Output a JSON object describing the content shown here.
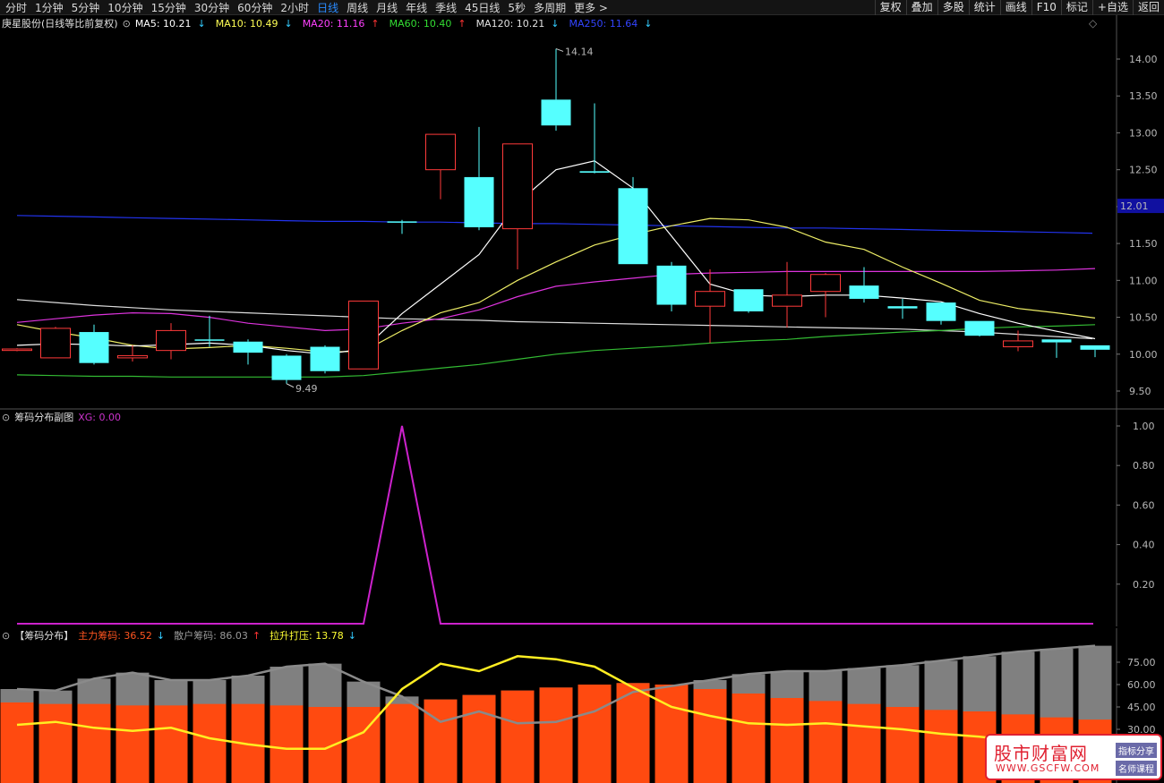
{
  "toolbar": {
    "periods": [
      "分时",
      "1分钟",
      "5分钟",
      "10分钟",
      "15分钟",
      "30分钟",
      "60分钟",
      "2小时",
      "日线",
      "周线",
      "月线",
      "年线",
      "季线",
      "45日线",
      "5秒",
      "多周期",
      "更多 >"
    ],
    "active_period": "日线",
    "tools": [
      "复权",
      "叠加",
      "多股",
      "统计",
      "画线",
      "F10",
      "标记",
      "+自选",
      "返回"
    ]
  },
  "main_panel": {
    "title": "庚星股份(日线等比前复权)",
    "ma": [
      {
        "label": "MA5: 10.21",
        "arrow": "↓",
        "color": "#ffffff"
      },
      {
        "label": "MA10: 10.49",
        "arrow": "↓",
        "color": "#ffff55"
      },
      {
        "label": "MA20: 11.16",
        "arrow": "↑",
        "color": "#ff40ff"
      },
      {
        "label": "MA60: 10.40",
        "arrow": "↑",
        "color": "#33dd33"
      },
      {
        "label": "MA120: 10.21",
        "arrow": "↓",
        "color": "#e0e0e0"
      },
      {
        "label": "MA250: 11.64",
        "arrow": "↓",
        "color": "#3344ff"
      }
    ],
    "price_ticks": [
      "14.00",
      "13.50",
      "13.00",
      "12.50",
      "12.00",
      "11.50",
      "11.00",
      "10.50",
      "10.00",
      "9.50"
    ],
    "current_price_tag": "12.01",
    "high_label": "14.14",
    "low_label": "9.49",
    "candles": [
      {
        "o": 10.05,
        "c": 10.07,
        "h": 10.08,
        "l": 10.04
      },
      {
        "o": 9.95,
        "c": 10.35,
        "h": 10.37,
        "l": 9.95
      },
      {
        "o": 10.3,
        "c": 9.88,
        "h": 10.4,
        "l": 9.86
      },
      {
        "o": 9.95,
        "c": 9.98,
        "h": 10.12,
        "l": 9.9
      },
      {
        "o": 10.05,
        "c": 10.32,
        "h": 10.42,
        "l": 9.93
      },
      {
        "o": 10.2,
        "c": 10.2,
        "h": 10.52,
        "l": 10.1
      },
      {
        "o": 10.17,
        "c": 10.02,
        "h": 10.2,
        "l": 9.86
      },
      {
        "o": 9.98,
        "c": 9.65,
        "h": 10.0,
        "l": 9.6
      },
      {
        "o": 10.1,
        "c": 9.77,
        "h": 10.12,
        "l": 9.74
      },
      {
        "o": 9.8,
        "c": 10.72,
        "h": 10.72,
        "l": 9.8
      },
      {
        "o": 11.8,
        "c": 11.8,
        "h": 11.82,
        "l": 11.63
      },
      {
        "o": 12.5,
        "c": 12.98,
        "h": 12.98,
        "l": 12.1
      },
      {
        "o": 12.4,
        "c": 11.72,
        "h": 13.08,
        "l": 11.68
      },
      {
        "o": 11.7,
        "c": 12.85,
        "h": 12.85,
        "l": 11.15
      },
      {
        "o": 13.45,
        "c": 13.1,
        "h": 14.14,
        "l": 13.03
      },
      {
        "o": 12.48,
        "c": 12.46,
        "h": 13.4,
        "l": 12.45
      },
      {
        "o": 12.25,
        "c": 11.22,
        "h": 12.4,
        "l": 11.22
      },
      {
        "o": 11.2,
        "c": 10.67,
        "h": 11.25,
        "l": 10.58
      },
      {
        "o": 10.65,
        "c": 10.85,
        "h": 11.15,
        "l": 10.15
      },
      {
        "o": 10.88,
        "c": 10.58,
        "h": 10.88,
        "l": 10.56
      },
      {
        "o": 10.65,
        "c": 10.8,
        "h": 11.25,
        "l": 10.36
      },
      {
        "o": 10.85,
        "c": 11.08,
        "h": 11.1,
        "l": 10.5
      },
      {
        "o": 10.93,
        "c": 10.75,
        "h": 11.18,
        "l": 10.7
      },
      {
        "o": 10.65,
        "c": 10.62,
        "h": 10.75,
        "l": 10.48
      },
      {
        "o": 10.7,
        "c": 10.45,
        "h": 10.7,
        "l": 10.4
      },
      {
        "o": 10.45,
        "c": 10.25,
        "h": 10.45,
        "l": 10.24
      },
      {
        "o": 10.1,
        "c": 10.18,
        "h": 10.32,
        "l": 10.04
      },
      {
        "o": 10.2,
        "c": 10.16,
        "h": 10.2,
        "l": 9.95
      },
      {
        "o": 10.12,
        "c": 10.06,
        "h": 10.12,
        "l": 9.96
      }
    ],
    "ma_lines": {
      "ma5": [
        10.12,
        10.14,
        10.13,
        10.11,
        10.13,
        10.15,
        10.12,
        10.05,
        10.0,
        10.07,
        10.55,
        10.95,
        11.35,
        12.05,
        12.5,
        12.62,
        12.25,
        11.6,
        10.95,
        10.8,
        10.78,
        10.8,
        10.8,
        10.76,
        10.71,
        10.55,
        10.42,
        10.31,
        10.21
      ],
      "ma10": [
        10.4,
        10.3,
        10.22,
        10.12,
        10.07,
        10.09,
        10.12,
        10.08,
        10.03,
        10.04,
        10.32,
        10.56,
        10.7,
        11.0,
        11.25,
        11.48,
        11.62,
        11.74,
        11.84,
        11.82,
        11.72,
        11.52,
        11.42,
        11.18,
        10.96,
        10.73,
        10.62,
        10.56,
        10.49
      ],
      "ma20": [
        10.43,
        10.48,
        10.53,
        10.56,
        10.55,
        10.5,
        10.42,
        10.37,
        10.32,
        10.34,
        10.42,
        10.48,
        10.6,
        10.78,
        10.92,
        10.98,
        11.03,
        11.08,
        11.1,
        11.11,
        11.12,
        11.12,
        11.12,
        11.12,
        11.12,
        11.12,
        11.13,
        11.14,
        11.16
      ],
      "ma60": [
        9.72,
        9.71,
        9.7,
        9.7,
        9.69,
        9.69,
        9.69,
        9.69,
        9.69,
        9.71,
        9.76,
        9.81,
        9.86,
        9.93,
        10.0,
        10.05,
        10.08,
        10.11,
        10.15,
        10.18,
        10.2,
        10.24,
        10.27,
        10.3,
        10.32,
        10.35,
        10.37,
        10.38,
        10.4
      ],
      "ma120": [
        10.74,
        10.7,
        10.66,
        10.63,
        10.6,
        10.58,
        10.56,
        10.54,
        10.52,
        10.5,
        10.48,
        10.47,
        10.46,
        10.44,
        10.43,
        10.42,
        10.41,
        10.4,
        10.39,
        10.38,
        10.37,
        10.36,
        10.35,
        10.34,
        10.32,
        10.3,
        10.27,
        10.24,
        10.21
      ],
      "ma250": [
        11.88,
        11.87,
        11.86,
        11.85,
        11.84,
        11.83,
        11.82,
        11.81,
        11.8,
        11.8,
        11.79,
        11.79,
        11.78,
        11.77,
        11.77,
        11.76,
        11.75,
        11.74,
        11.73,
        11.72,
        11.71,
        11.71,
        11.7,
        11.69,
        11.68,
        11.67,
        11.66,
        11.65,
        11.64
      ]
    }
  },
  "sub_panel1": {
    "title": "筹码分布副图",
    "xg_label": "XG: 0.00",
    "ticks": [
      "1.00",
      "0.80",
      "0.60",
      "0.40",
      "0.20"
    ],
    "xg_values": [
      0,
      0,
      0,
      0,
      0,
      0,
      0,
      0,
      0,
      0,
      1,
      0,
      0,
      0,
      0,
      0,
      0,
      0,
      0,
      0,
      0,
      0,
      0,
      0,
      0,
      0,
      0,
      0,
      0
    ]
  },
  "sub_panel2": {
    "title": "【筹码分布】",
    "main_label": "主力筹码: 36.52",
    "main_arrow": "↓",
    "retail_label": "散户筹码: 86.03",
    "retail_arrow": "↑",
    "pressure_label": "拉升打压: 13.78",
    "pressure_arrow": "↓",
    "ticks": [
      "75.00",
      "60.00",
      "45.00",
      "30.00"
    ],
    "main_values": [
      48,
      47,
      47,
      46,
      46,
      47,
      47,
      46,
      45,
      45,
      47,
      50,
      53,
      56,
      58,
      60,
      61,
      60,
      57,
      54,
      51,
      49,
      47,
      45,
      43,
      42,
      40,
      38,
      36.52
    ],
    "retail_values": [
      57,
      56,
      64,
      68,
      63,
      63,
      66,
      72,
      74,
      62,
      52,
      35,
      42,
      34,
      35,
      42,
      55,
      59,
      63,
      67,
      69,
      69,
      71,
      73,
      76,
      79,
      82,
      84,
      86.03
    ],
    "pressure_values": [
      33,
      35,
      31,
      29,
      31,
      24,
      20,
      17,
      17,
      28,
      57,
      74,
      69,
      79,
      77,
      72,
      58,
      45,
      39,
      34,
      33,
      34,
      32,
      30,
      27,
      25,
      22,
      18,
      13.78
    ]
  },
  "watermark": {
    "title": "股市财富网",
    "url": "WWW.GSCFW.COM",
    "tag1": "指标分享",
    "tag2": "名师课程"
  }
}
